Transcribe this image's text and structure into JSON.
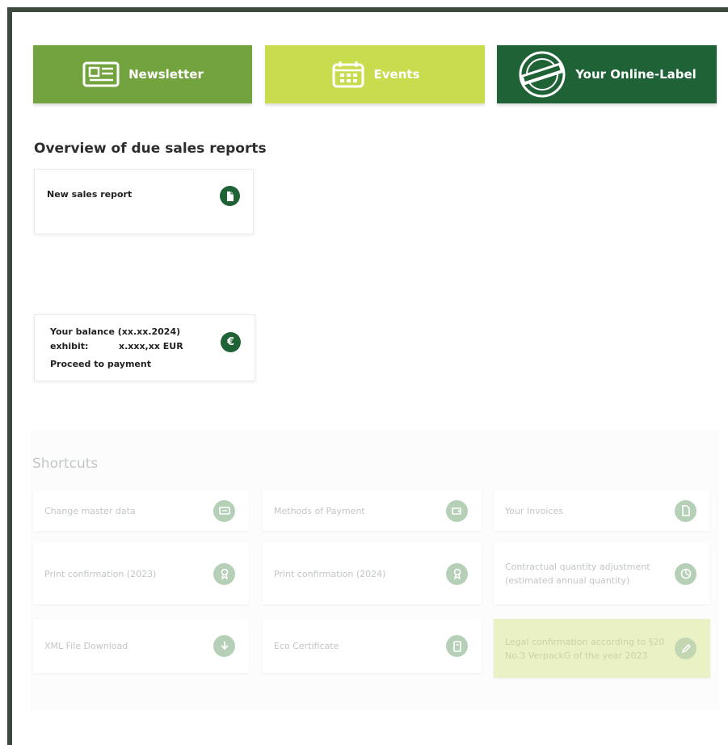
{
  "tiles": {
    "newsletter": "Newsletter",
    "events": "Events",
    "online_label": "Your Online-Label"
  },
  "overview": {
    "title": "Overview of due sales reports",
    "new_sales_report": "New sales report"
  },
  "balance": {
    "line1": "Your balance (xx.xx.2024)",
    "exhibit_label": "exhibit:",
    "exhibit_value": "x.xxx,xx EUR",
    "proceed": "Proceed  to  payment",
    "currency_symbol": "€"
  },
  "shortcuts": {
    "title": "Shortcuts",
    "items": [
      {
        "label": "Change master data",
        "icon": "id-card-icon"
      },
      {
        "label": "Methods of Payment",
        "icon": "wallet-icon"
      },
      {
        "label": "Your Invoices",
        "icon": "invoice-icon"
      },
      {
        "label": "Print confirmation (2023)",
        "icon": "award-icon"
      },
      {
        "label": "Print confirmation (2024)",
        "icon": "award-icon"
      },
      {
        "label": "Contractual quantity adjustment (estimated annual quantity)",
        "icon": "chart-icon"
      },
      {
        "label": "XML File Download",
        "icon": "download-icon"
      },
      {
        "label": "Eco Certificate",
        "icon": "certificate-icon"
      },
      {
        "label": "Legal confirmation according to §20 No.3 VerpackG of the year 2023",
        "icon": "edit-icon"
      }
    ]
  },
  "colors": {
    "dark_green": "#1f6236",
    "medium_green": "#72a33e",
    "lime": "#c9dc4e",
    "highlight": "#eaf2c5"
  }
}
